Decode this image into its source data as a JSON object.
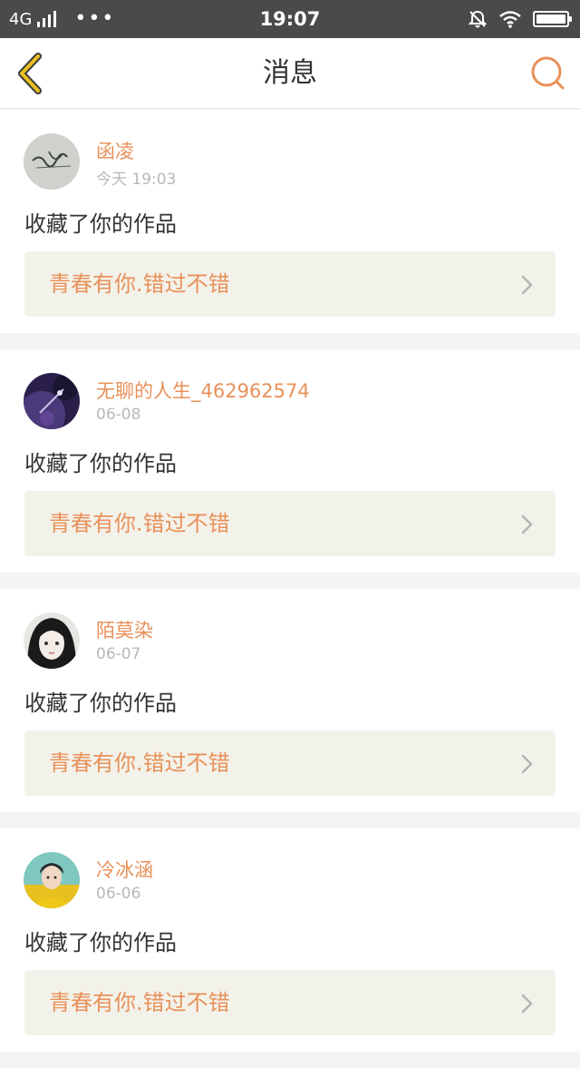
{
  "status_bar": {
    "network": "4G",
    "more": "•••",
    "time": "19:07",
    "icons": [
      "signal-icon",
      "mute-bell-icon",
      "wifi-icon",
      "battery-icon"
    ]
  },
  "header": {
    "title": "消息",
    "accent_color": "#e8915a"
  },
  "messages": [
    {
      "user": "函凌",
      "time": "今天 19:03",
      "action": "收藏了你的作品",
      "work_title": "青春有你.错过不错"
    },
    {
      "user": "无聊的人生_462962574",
      "time": "06-08",
      "action": "收藏了你的作品",
      "work_title": "青春有你.错过不错"
    },
    {
      "user": "陌莫染",
      "time": "06-07",
      "action": "收藏了你的作品",
      "work_title": "青春有你.错过不错"
    },
    {
      "user": "冷冰涵",
      "time": "06-06",
      "action": "收藏了你的作品",
      "work_title": "青春有你.错过不错"
    }
  ]
}
